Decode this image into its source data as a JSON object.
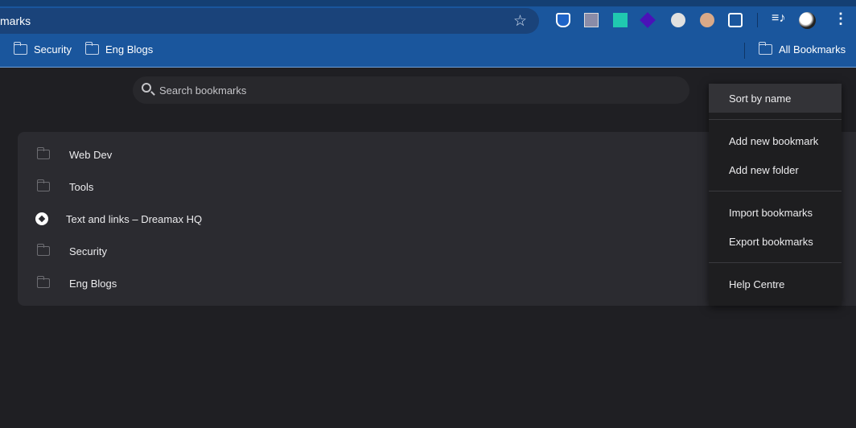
{
  "omnibox": {
    "text": "marks"
  },
  "bookmarks_bar": {
    "items": [
      "Security",
      "Eng Blogs"
    ],
    "all_bookmarks": "All Bookmarks"
  },
  "search": {
    "placeholder": "Search bookmarks"
  },
  "list": [
    {
      "label": "Web Dev",
      "type": "folder"
    },
    {
      "label": "Tools",
      "type": "folder"
    },
    {
      "label": "Text and links – Dreamax HQ",
      "type": "link"
    },
    {
      "label": "Security",
      "type": "folder"
    },
    {
      "label": "Eng Blogs",
      "type": "folder"
    }
  ],
  "menu": {
    "sort": "Sort by name",
    "add_bookmark": "Add new bookmark",
    "add_folder": "Add new folder",
    "import": "Import bookmarks",
    "export": "Export bookmarks",
    "help": "Help Centre"
  }
}
